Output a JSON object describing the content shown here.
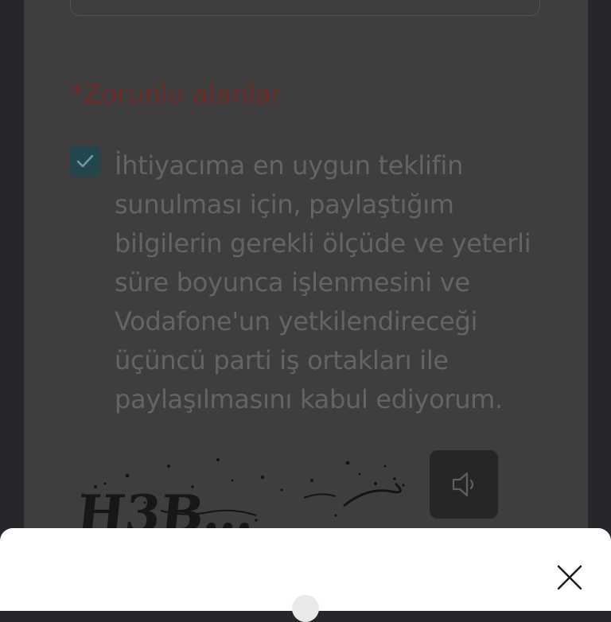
{
  "form": {
    "required_note": "*Zorunlu alanlar",
    "consent_checked": true,
    "consent_text": "İhtiyacıma en uygun teklifin sunulması için, paylaştığım bilgilerin gerekli ölçüde ve yeterli süre boyunca işlenmesini ve Vodafone'un yetkilendireceği üçüncü parti iş ortakları ile paylaşılmasını kabul ediyorum.",
    "captcha_text": "H3B…",
    "audio_icon": "speaker-icon"
  },
  "sheet": {
    "close_icon": "close-icon"
  },
  "colors": {
    "overlay_background": "#26272a",
    "form_background": "#3e3e3e",
    "required_note": "#6b2a28",
    "checkbox": "#23454c",
    "body_text": "#646464",
    "sheet_background": "#ffffff"
  }
}
